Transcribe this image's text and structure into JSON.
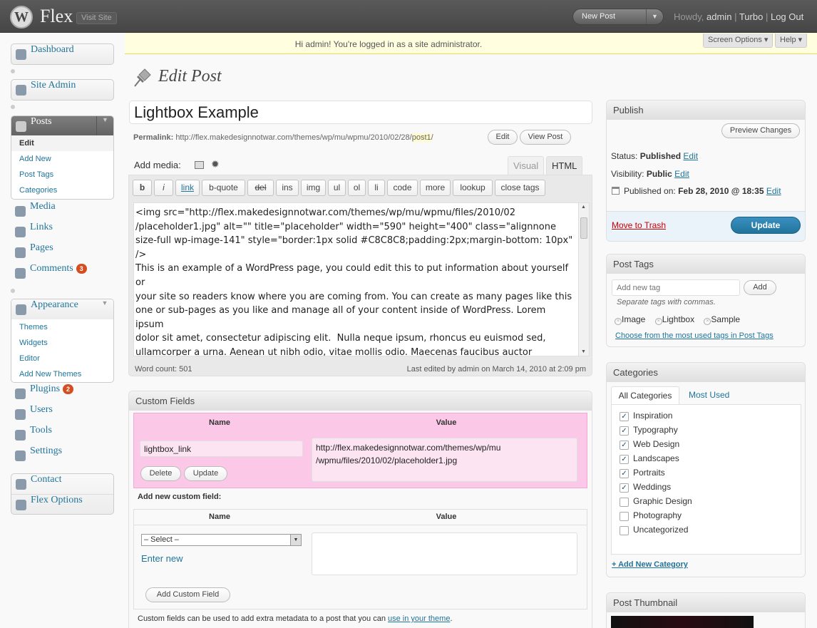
{
  "header": {
    "logo": "W",
    "site_name": "Flex",
    "visit_site": "Visit Site",
    "new_post": "New Post",
    "howdy": "Howdy,",
    "user": "admin",
    "sep1": "|",
    "turbo": "Turbo",
    "sep2": "|",
    "logout": "Log Out"
  },
  "notice": {
    "text": "Hi admin! You're logged in as a site administrator.",
    "screen_options": "Screen Options ▾",
    "help": "Help ▾"
  },
  "sidebar": {
    "dashboard": "Dashboard",
    "site_admin": "Site Admin",
    "posts": "Posts",
    "posts_sub": [
      "Edit",
      "Add New",
      "Post Tags",
      "Categories"
    ],
    "media": "Media",
    "links": "Links",
    "pages": "Pages",
    "comments": "Comments",
    "comments_count": "3",
    "appearance": "Appearance",
    "appearance_sub": [
      "Themes",
      "Widgets",
      "Editor",
      "Add New Themes"
    ],
    "plugins": "Plugins",
    "plugins_count": "2",
    "users": "Users",
    "tools": "Tools",
    "settings": "Settings",
    "contact": "Contact",
    "flex_options": "Flex Options"
  },
  "page": {
    "title": "Edit Post"
  },
  "post": {
    "title": "Lightbox Example",
    "permalink_label": "Permalink:",
    "permalink_base": "http://flex.makedesignnotwar.com/themes/wp/mu/wpmu/2010/02/28/",
    "permalink_slug": "post1",
    "permalink_end": "/",
    "edit_btn": "Edit",
    "view_btn": "View Post",
    "add_media": "Add media:",
    "tab_visual": "Visual",
    "tab_html": "HTML",
    "quicktags": [
      "b",
      "i",
      "link",
      "b-quote",
      "del",
      "ins",
      "img",
      "ul",
      "ol",
      "li",
      "code",
      "more",
      "lookup",
      "close tags"
    ],
    "content": "<img src=\"http://flex.makedesignnotwar.com/themes/wp/mu/wpmu/files/2010/02\n/placeholder1.jpg\" alt=\"\" title=\"placeholder\" width=\"590\" height=\"400\" class=\"alignnone\nsize-full wp-image-141\" style=\"border:1px solid #C8C8C8;padding:2px;margin-bottom: 10px\"\n/>\nThis is an example of a WordPress page, you could edit this to put information about yourself or\nyour site so readers know where you are coming from. You can create as many pages like this\none or sub-pages as you like and manage all of your content inside of WordPress. Lorem ipsum\ndolor sit amet, consectetur adipiscing elit.  Nulla neque ipsum, rhoncus eu euismod sed,\nullamcorper a urna. Aenean ut nibh odio, vitae mollis odio. Maecenas faucibus auctor interdum.\nNam commodo vehicula sapien sit amet aliquam. Nam eu diam ac dolor volutpat consequat vitae\nat neque. Ut at tortor nisi. Aliquam sit amet sapien nibh. Vivamus quis tellus id eros volutpat",
    "word_count": "Word count: 501",
    "last_edited": "Last edited by admin on March 14, 2010 at 2:09 pm"
  },
  "custom_fields": {
    "title": "Custom Fields",
    "col_name": "Name",
    "col_value": "Value",
    "field_name": "lightbox_link",
    "field_value": "http://flex.makedesignnotwar.com/themes/wp/mu\n/wpmu/files/2010/02/placeholder1.jpg",
    "delete": "Delete",
    "update": "Update",
    "add_new_label": "Add new custom field:",
    "select": "– Select –",
    "enter_new": "Enter new",
    "add_btn": "Add Custom Field",
    "footer": "Custom fields can be used to add extra metadata to a post that you can",
    "footer_link": "use in your theme",
    "footer_end": "."
  },
  "publish": {
    "title": "Publish",
    "preview": "Preview Changes",
    "status_label": "Status:",
    "status": "Published",
    "visibility_label": "Visibility:",
    "visibility": "Public",
    "published_label": "Published on:",
    "published_on": "Feb 28, 2010 @ 18:35",
    "edit": "Edit",
    "trash": "Move to Trash",
    "update": "Update"
  },
  "tags": {
    "title": "Post Tags",
    "placeholder": "Add new tag",
    "add": "Add",
    "hint": "Separate tags with commas.",
    "items": [
      "Image",
      "Lightbox",
      "Sample"
    ],
    "choose": "Choose from the most used tags in Post Tags"
  },
  "categories": {
    "title": "Categories",
    "tab_all": "All Categories",
    "tab_used": "Most Used",
    "items": [
      {
        "label": "Inspiration",
        "checked": true
      },
      {
        "label": "Typography",
        "checked": true
      },
      {
        "label": "Web Design",
        "checked": true
      },
      {
        "label": "Landscapes",
        "checked": true
      },
      {
        "label": "Portraits",
        "checked": true
      },
      {
        "label": "Weddings",
        "checked": true
      },
      {
        "label": "Graphic Design",
        "checked": false
      },
      {
        "label": "Photography",
        "checked": false
      },
      {
        "label": "Uncategorized",
        "checked": false
      }
    ],
    "add_new": "+ Add New Category"
  },
  "thumbnail": {
    "title": "Post Thumbnail"
  }
}
